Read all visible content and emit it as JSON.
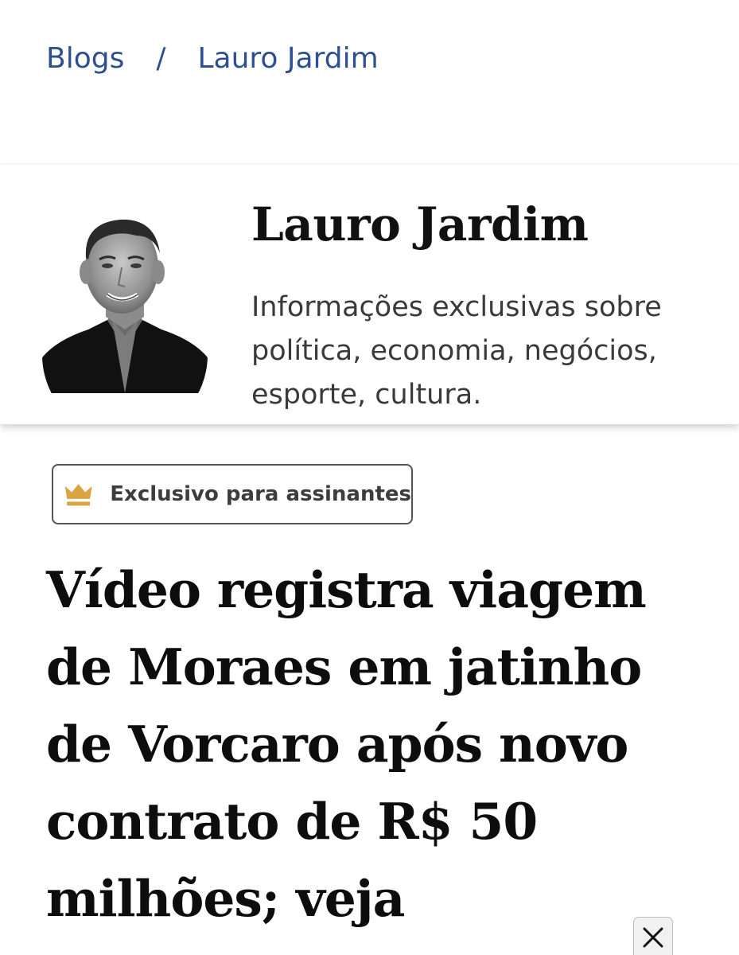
{
  "breadcrumb": {
    "items": [
      {
        "label": "Blogs"
      },
      {
        "label": "Lauro Jardim"
      }
    ],
    "separator": "/"
  },
  "blog": {
    "name": "Lauro Jardim",
    "description": "Informações exclusivas sobre política, economia, negócios, esporte, cultura.",
    "avatar_icon": "author-portrait"
  },
  "badge": {
    "label": "Exclusivo para assinantes",
    "icon": "crown-icon",
    "icon_color": "#d9a441"
  },
  "article": {
    "headline": "Vídeo registra viagem de Moraes em jatinho de Vorcaro após novo contrato de R$ 50 milhões; veja"
  },
  "overlay": {
    "close_icon": "close-icon"
  },
  "colors": {
    "link": "#2f4f93",
    "headline": "#0d0d0d"
  }
}
